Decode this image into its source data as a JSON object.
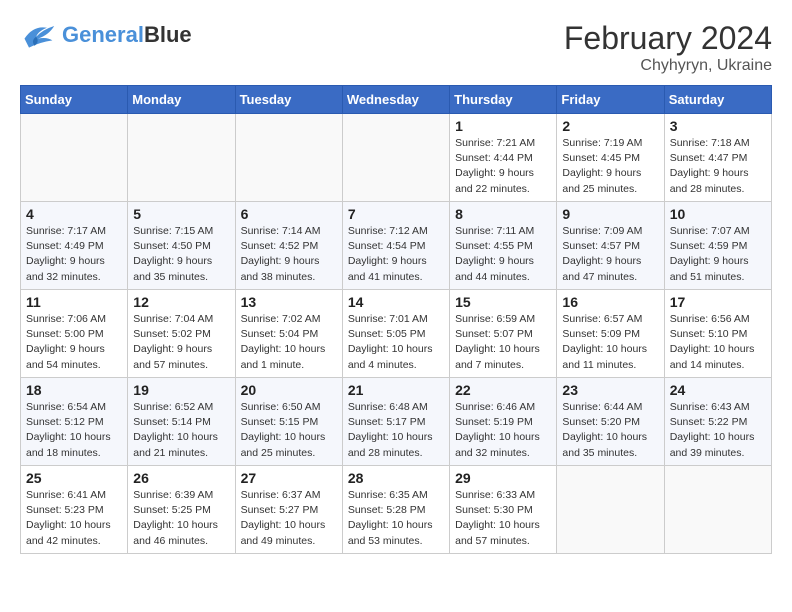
{
  "header": {
    "logo_general": "General",
    "logo_blue": "Blue",
    "month_year": "February 2024",
    "location": "Chyhyryn, Ukraine"
  },
  "calendar": {
    "days_of_week": [
      "Sunday",
      "Monday",
      "Tuesday",
      "Wednesday",
      "Thursday",
      "Friday",
      "Saturday"
    ],
    "weeks": [
      [
        {
          "day": "",
          "info": ""
        },
        {
          "day": "",
          "info": ""
        },
        {
          "day": "",
          "info": ""
        },
        {
          "day": "",
          "info": ""
        },
        {
          "day": "1",
          "info": "Sunrise: 7:21 AM\nSunset: 4:44 PM\nDaylight: 9 hours\nand 22 minutes."
        },
        {
          "day": "2",
          "info": "Sunrise: 7:19 AM\nSunset: 4:45 PM\nDaylight: 9 hours\nand 25 minutes."
        },
        {
          "day": "3",
          "info": "Sunrise: 7:18 AM\nSunset: 4:47 PM\nDaylight: 9 hours\nand 28 minutes."
        }
      ],
      [
        {
          "day": "4",
          "info": "Sunrise: 7:17 AM\nSunset: 4:49 PM\nDaylight: 9 hours\nand 32 minutes."
        },
        {
          "day": "5",
          "info": "Sunrise: 7:15 AM\nSunset: 4:50 PM\nDaylight: 9 hours\nand 35 minutes."
        },
        {
          "day": "6",
          "info": "Sunrise: 7:14 AM\nSunset: 4:52 PM\nDaylight: 9 hours\nand 38 minutes."
        },
        {
          "day": "7",
          "info": "Sunrise: 7:12 AM\nSunset: 4:54 PM\nDaylight: 9 hours\nand 41 minutes."
        },
        {
          "day": "8",
          "info": "Sunrise: 7:11 AM\nSunset: 4:55 PM\nDaylight: 9 hours\nand 44 minutes."
        },
        {
          "day": "9",
          "info": "Sunrise: 7:09 AM\nSunset: 4:57 PM\nDaylight: 9 hours\nand 47 minutes."
        },
        {
          "day": "10",
          "info": "Sunrise: 7:07 AM\nSunset: 4:59 PM\nDaylight: 9 hours\nand 51 minutes."
        }
      ],
      [
        {
          "day": "11",
          "info": "Sunrise: 7:06 AM\nSunset: 5:00 PM\nDaylight: 9 hours\nand 54 minutes."
        },
        {
          "day": "12",
          "info": "Sunrise: 7:04 AM\nSunset: 5:02 PM\nDaylight: 9 hours\nand 57 minutes."
        },
        {
          "day": "13",
          "info": "Sunrise: 7:02 AM\nSunset: 5:04 PM\nDaylight: 10 hours\nand 1 minute."
        },
        {
          "day": "14",
          "info": "Sunrise: 7:01 AM\nSunset: 5:05 PM\nDaylight: 10 hours\nand 4 minutes."
        },
        {
          "day": "15",
          "info": "Sunrise: 6:59 AM\nSunset: 5:07 PM\nDaylight: 10 hours\nand 7 minutes."
        },
        {
          "day": "16",
          "info": "Sunrise: 6:57 AM\nSunset: 5:09 PM\nDaylight: 10 hours\nand 11 minutes."
        },
        {
          "day": "17",
          "info": "Sunrise: 6:56 AM\nSunset: 5:10 PM\nDaylight: 10 hours\nand 14 minutes."
        }
      ],
      [
        {
          "day": "18",
          "info": "Sunrise: 6:54 AM\nSunset: 5:12 PM\nDaylight: 10 hours\nand 18 minutes."
        },
        {
          "day": "19",
          "info": "Sunrise: 6:52 AM\nSunset: 5:14 PM\nDaylight: 10 hours\nand 21 minutes."
        },
        {
          "day": "20",
          "info": "Sunrise: 6:50 AM\nSunset: 5:15 PM\nDaylight: 10 hours\nand 25 minutes."
        },
        {
          "day": "21",
          "info": "Sunrise: 6:48 AM\nSunset: 5:17 PM\nDaylight: 10 hours\nand 28 minutes."
        },
        {
          "day": "22",
          "info": "Sunrise: 6:46 AM\nSunset: 5:19 PM\nDaylight: 10 hours\nand 32 minutes."
        },
        {
          "day": "23",
          "info": "Sunrise: 6:44 AM\nSunset: 5:20 PM\nDaylight: 10 hours\nand 35 minutes."
        },
        {
          "day": "24",
          "info": "Sunrise: 6:43 AM\nSunset: 5:22 PM\nDaylight: 10 hours\nand 39 minutes."
        }
      ],
      [
        {
          "day": "25",
          "info": "Sunrise: 6:41 AM\nSunset: 5:23 PM\nDaylight: 10 hours\nand 42 minutes."
        },
        {
          "day": "26",
          "info": "Sunrise: 6:39 AM\nSunset: 5:25 PM\nDaylight: 10 hours\nand 46 minutes."
        },
        {
          "day": "27",
          "info": "Sunrise: 6:37 AM\nSunset: 5:27 PM\nDaylight: 10 hours\nand 49 minutes."
        },
        {
          "day": "28",
          "info": "Sunrise: 6:35 AM\nSunset: 5:28 PM\nDaylight: 10 hours\nand 53 minutes."
        },
        {
          "day": "29",
          "info": "Sunrise: 6:33 AM\nSunset: 5:30 PM\nDaylight: 10 hours\nand 57 minutes."
        },
        {
          "day": "",
          "info": ""
        },
        {
          "day": "",
          "info": ""
        }
      ]
    ]
  }
}
